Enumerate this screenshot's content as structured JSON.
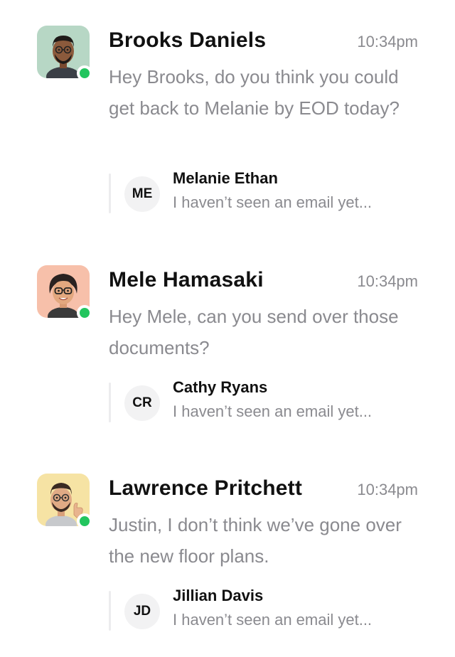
{
  "threads": [
    {
      "name": "Brooks Daniels",
      "time": "10:34pm",
      "message": "Hey Brooks, do you think you could get back to Melanie by EOD today?",
      "online": true,
      "avatar_bg": "#b7d7c5",
      "reply": {
        "initials": "ME",
        "name": "Melanie Ethan",
        "snippet": "I haven’t seen an email yet..."
      }
    },
    {
      "name": "Mele Hamasaki",
      "time": "10:34pm",
      "message": "Hey Mele, can you send over those documents?",
      "online": true,
      "avatar_bg": "#f7c0aa",
      "reply": {
        "initials": "CR",
        "name": "Cathy Ryans",
        "snippet": "I haven’t seen an email yet..."
      }
    },
    {
      "name": "Lawrence Pritchett",
      "time": "10:34pm",
      "message": "Justin, I don’t think we’ve gone over the new floor plans.",
      "online": true,
      "avatar_bg": "#f6e3a4",
      "reply": {
        "initials": "JD",
        "name": "Jillian Davis",
        "snippet": "I haven’t seen an email yet..."
      }
    }
  ],
  "colors": {
    "online": "#22c55e",
    "muted_text": "#8a8a8f",
    "primary_text": "#111111"
  }
}
